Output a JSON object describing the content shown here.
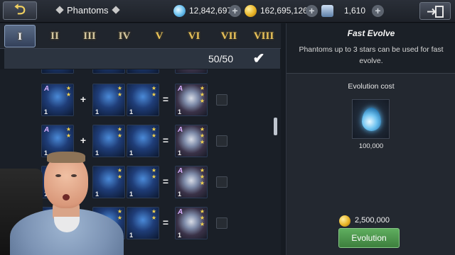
{
  "topbar": {
    "title": "Phantoms",
    "resources": [
      {
        "name": "crystals",
        "value": "12,842,697",
        "icon": "crystal-icon",
        "color": "#6fc3f0"
      },
      {
        "name": "gold",
        "value": "162,695,126",
        "icon": "gold-coin-icon",
        "color": "#e8b426"
      },
      {
        "name": "tickets",
        "value": "1,610",
        "icon": "ticket-icon",
        "color": "#9fb6d2"
      }
    ]
  },
  "tabs": [
    {
      "label": "I",
      "active": true
    },
    {
      "label": "II",
      "active": false
    },
    {
      "label": "III",
      "active": false
    },
    {
      "label": "IV",
      "active": false
    },
    {
      "label": "V",
      "active": false
    },
    {
      "label": "VI",
      "active": false
    },
    {
      "label": "VII",
      "active": false
    },
    {
      "label": "VIII",
      "active": false
    }
  ],
  "count": {
    "text": "50/50",
    "checked": true
  },
  "rows": [
    {
      "plus": "+",
      "equals": "=",
      "level": "1"
    },
    {
      "plus": "+",
      "equals": "=",
      "level": "1"
    },
    {
      "plus": "+",
      "equals": "=",
      "level": "1"
    },
    {
      "plus": "+",
      "equals": "=",
      "level": "1"
    }
  ],
  "panel": {
    "title": "Fast Evolve",
    "description": "Phantoms up to 3 stars can be used for fast evolve.",
    "cost_label": "Evolution cost",
    "item_quantity": "100,000",
    "gold_cost": "2,500,000",
    "button_label": "Evolution"
  },
  "colors": {
    "accent_gold": "#e8c25a",
    "button_green": "#4c934c",
    "active_tab": "#5a6b86"
  }
}
